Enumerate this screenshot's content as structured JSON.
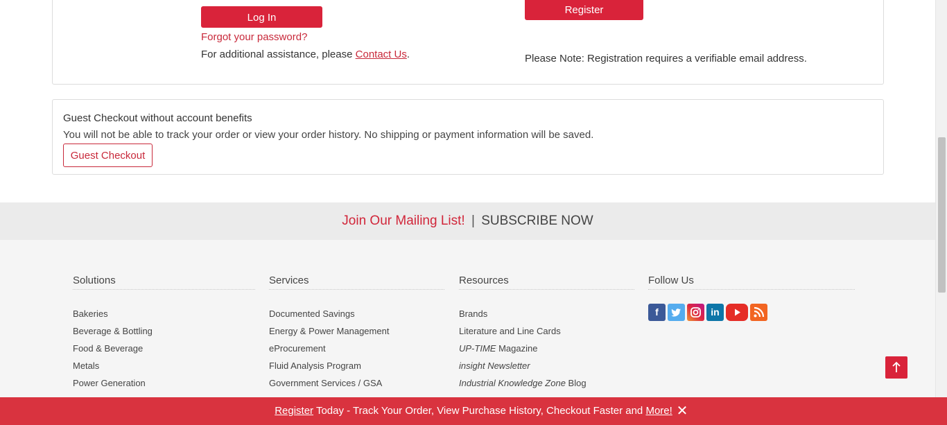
{
  "login": {
    "login_button": "Log In",
    "forgot_link": "Forgot your password?",
    "assist_prefix": "For additional assistance, please ",
    "contact_link": "Contact Us",
    "assist_suffix": "."
  },
  "register": {
    "register_button": "Register",
    "note": "Please Note: Registration requires a verifiable email address."
  },
  "guest": {
    "title": "Guest Checkout without account benefits",
    "description": "You will not be able to track your order or view your order history. No shipping or payment information will be saved.",
    "button": "Guest Checkout"
  },
  "mailing": {
    "join": "Join Our Mailing List!",
    "separator": "|",
    "subscribe": "SUBSCRIBE NOW"
  },
  "footer": {
    "solutions": {
      "heading": "Solutions",
      "items": [
        "Bakeries",
        "Beverage & Bottling",
        "Food & Beverage",
        "Metals",
        "Power Generation"
      ]
    },
    "services": {
      "heading": "Services",
      "items": [
        "Documented Savings",
        "Energy & Power Management",
        "eProcurement",
        "Fluid Analysis Program",
        "Government Services / GSA"
      ]
    },
    "resources": {
      "heading": "Resources",
      "items": [
        "Brands",
        "Literature and Line Cards",
        "UP-TIME",
        " Magazine",
        "insight",
        " Newsletter",
        "Industrial Knowledge Zone",
        " Blog"
      ]
    },
    "follow": {
      "heading": "Follow Us",
      "icons": [
        "facebook-icon",
        "twitter-icon",
        "instagram-icon",
        "linkedin-icon",
        "youtube-icon",
        "rss-icon"
      ]
    }
  },
  "bottom_bar": {
    "register_link": "Register",
    "middle": " Today - Track Your Order, View Purchase History, Checkout Faster and ",
    "more_link": "More!",
    "close": "✕"
  },
  "colors": {
    "brand_red": "#d9233a",
    "bar_red": "#d9333f"
  }
}
